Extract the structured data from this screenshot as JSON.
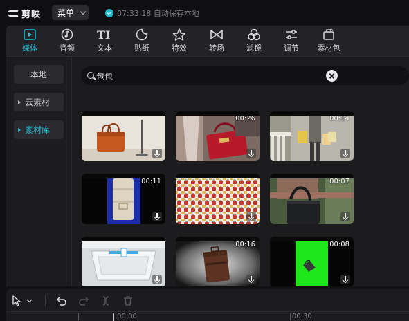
{
  "app": {
    "name": "剪映",
    "menu_label": "菜单",
    "save_status": "07:33:18 自动保存本地"
  },
  "toolbar": {
    "tabs": [
      {
        "label": "媒体",
        "icon": "media-icon",
        "active": true
      },
      {
        "label": "音频",
        "icon": "audio-icon",
        "active": false
      },
      {
        "label": "文本",
        "icon": "text-icon",
        "active": false
      },
      {
        "label": "贴纸",
        "icon": "sticker-icon",
        "active": false
      },
      {
        "label": "特效",
        "icon": "effects-icon",
        "active": false
      },
      {
        "label": "转场",
        "icon": "transition-icon",
        "active": false
      },
      {
        "label": "滤镜",
        "icon": "filter-icon",
        "active": false
      },
      {
        "label": "调节",
        "icon": "adjust-icon",
        "active": false
      },
      {
        "label": "素材包",
        "icon": "material-pack-icon",
        "active": false
      }
    ]
  },
  "sidebar": {
    "items": [
      {
        "label": "本地",
        "active": false,
        "has_arrow": false
      },
      {
        "label": "云素材",
        "active": false,
        "has_arrow": true
      },
      {
        "label": "素材库",
        "active": true,
        "has_arrow": true
      }
    ]
  },
  "search": {
    "value": "包包",
    "placeholder": ""
  },
  "media_grid": {
    "items": [
      {
        "duration": "",
        "scene": "orange handbag on stand"
      },
      {
        "duration": "00:26",
        "scene": "red handbag hands"
      },
      {
        "duration": "00:14",
        "scene": "shopping bags walking"
      },
      {
        "duration": "00:11",
        "scene": "beige clutch on blue"
      },
      {
        "duration": "",
        "scene": "bag pattern grid"
      },
      {
        "duration": "00:07",
        "scene": "dark leather bag"
      },
      {
        "duration": "",
        "scene": "white box 3d"
      },
      {
        "duration": "00:16",
        "scene": "brown luggage"
      },
      {
        "duration": "00:08",
        "scene": "green screen bag"
      }
    ]
  },
  "timeline": {
    "ruler_labels": [
      "00:00",
      "00:30"
    ]
  },
  "colors": {
    "accent": "#21c0d4",
    "background": "#101012",
    "panel": "#1c1c1f"
  }
}
